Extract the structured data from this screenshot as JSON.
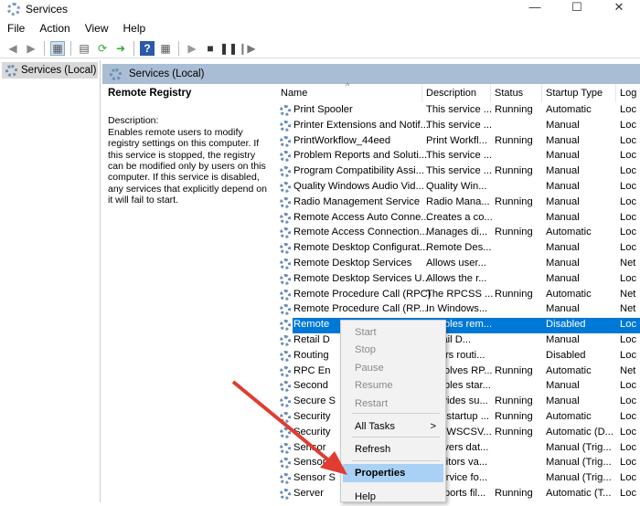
{
  "window": {
    "title": "Services",
    "controls": [
      "—",
      "☐",
      "✕"
    ]
  },
  "menubar": [
    "File",
    "Action",
    "View",
    "Help"
  ],
  "tree": {
    "item": "Services (Local)"
  },
  "band": {
    "title": "Services (Local)"
  },
  "details": {
    "title": "Remote Registry",
    "desc_label": "Description:",
    "desc": "Enables remote users to modify registry settings on this computer. If this service is stopped, the registry can be modified only by users on this computer. If this service is disabled, any services that explicitly depend on it will fail to start."
  },
  "columns": [
    "Name",
    "Description",
    "Status",
    "Startup Type",
    "Log"
  ],
  "rows": [
    [
      "Print Spooler",
      "This service ...",
      "Running",
      "Automatic",
      "Loc"
    ],
    [
      "Printer Extensions and Notif...",
      "This service ...",
      "",
      "Manual",
      "Loc"
    ],
    [
      "PrintWorkflow_44eed",
      "Print Workfl...",
      "Running",
      "Manual",
      "Loc"
    ],
    [
      "Problem Reports and Soluti...",
      "This service ...",
      "",
      "Manual",
      "Loc"
    ],
    [
      "Program Compatibility Assi...",
      "This service ...",
      "Running",
      "Manual",
      "Loc"
    ],
    [
      "Quality Windows Audio Vid...",
      "Quality Win...",
      "",
      "Manual",
      "Loc"
    ],
    [
      "Radio Management Service",
      "Radio Mana...",
      "Running",
      "Manual",
      "Loc"
    ],
    [
      "Remote Access Auto Conne...",
      "Creates a co...",
      "",
      "Manual",
      "Loc"
    ],
    [
      "Remote Access Connection...",
      "Manages di...",
      "Running",
      "Automatic",
      "Loc"
    ],
    [
      "Remote Desktop Configurat...",
      "Remote Des...",
      "",
      "Manual",
      "Loc"
    ],
    [
      "Remote Desktop Services",
      "Allows user...",
      "",
      "Manual",
      "Net"
    ],
    [
      "Remote Desktop Services U...",
      "Allows the r...",
      "",
      "Manual",
      "Loc"
    ],
    [
      "Remote Procedure Call (RPC)",
      "The RPCSS ...",
      "Running",
      "Automatic",
      "Net"
    ],
    [
      "Remote Procedure Call (RP...",
      "In Windows...",
      "",
      "Manual",
      "Net"
    ],
    [
      "Remote",
      "Enables rem...",
      "",
      "Disabled",
      "Loc"
    ],
    [
      "Retail D",
      "Retail D...",
      "",
      "Manual",
      "Loc"
    ],
    [
      "Routing",
      "Offers routi...",
      "",
      "Disabled",
      "Loc"
    ],
    [
      "RPC En",
      "Resolves RP...",
      "Running",
      "Automatic",
      "Net"
    ],
    [
      "Second",
      "Enables star...",
      "",
      "Manual",
      "Loc"
    ],
    [
      "Secure S",
      "Provides su...",
      "Running",
      "Manual",
      "Loc"
    ],
    [
      "Security",
      "The startup ...",
      "Running",
      "Automatic",
      "Loc"
    ],
    [
      "Security",
      "The WSCSV...",
      "Running",
      "Automatic (D...",
      "Loc"
    ],
    [
      "Sensor",
      "Delivers dat...",
      "",
      "Manual (Trig...",
      "Loc"
    ],
    [
      "Sensor",
      "Monitors va...",
      "",
      "Manual (Trig...",
      "Loc"
    ],
    [
      "Sensor S",
      "A service fo...",
      "",
      "Manual (Trig...",
      "Loc"
    ],
    [
      "Server",
      "Supports fil...",
      "Running",
      "Automatic (T...",
      "Loc"
    ]
  ],
  "selected_row": 14,
  "context_menu": {
    "items": [
      {
        "label": "Start",
        "disabled": true
      },
      {
        "label": "Stop",
        "disabled": true
      },
      {
        "label": "Pause",
        "disabled": true
      },
      {
        "label": "Resume",
        "disabled": true
      },
      {
        "label": "Restart",
        "disabled": true
      },
      {
        "label": "All Tasks",
        "submenu": ">"
      },
      {
        "label": "Refresh"
      },
      {
        "label": "Properties",
        "highlighted": true
      },
      {
        "label": "Help"
      }
    ]
  },
  "colors": {
    "band": "#a9bdd4",
    "selection": "#0078d7",
    "menu_highlight": "#a9d1f5",
    "arrow": "#e03c31"
  }
}
